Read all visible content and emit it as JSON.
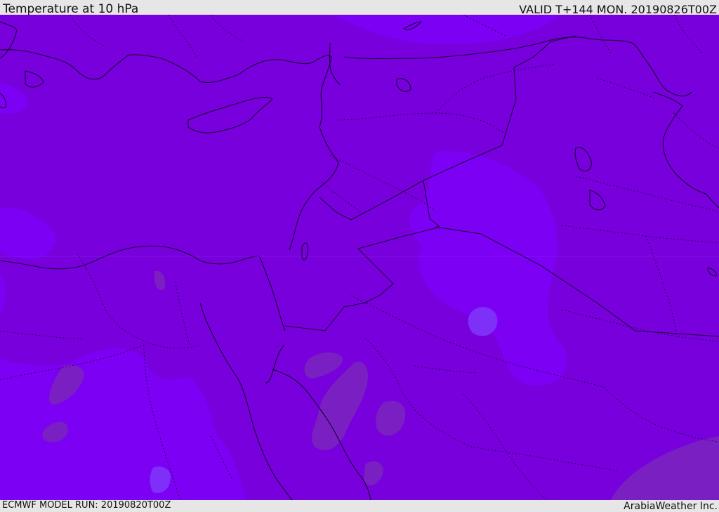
{
  "header": {
    "title": "Temperature at 10 hPa",
    "valid": "VALID T+144 MON. 20190826T00Z"
  },
  "footer": {
    "model_run": "ECMWF MODEL RUN: 20190820T00Z",
    "credit": "ArabiaWeather Inc."
  },
  "colors": {
    "base_field": "#7800dc",
    "warmer_field": "#7b00f4",
    "warmest_field": "#7e30f8",
    "cooler_field": "#7a1fc1",
    "coastline": "#1a0033",
    "background": "#e6e6e6"
  }
}
